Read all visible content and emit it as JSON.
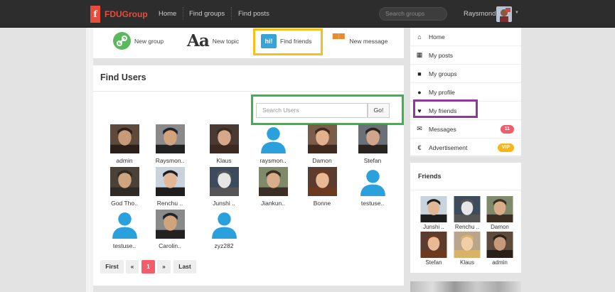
{
  "brand": {
    "logo_glyph": "f",
    "name": "FDUGroup",
    "color": "#e74c3c"
  },
  "nav": {
    "home": "Home",
    "find_groups": "Find groups",
    "find_posts": "Find posts"
  },
  "top_search": {
    "placeholder": "Search groups"
  },
  "user": {
    "name": "Raysmond"
  },
  "actions": {
    "new_group": "New group",
    "new_topic": "New topic",
    "topic_icon_text": "Aa",
    "find_friends": "Find friends",
    "find_friends_icon_text": "hi!",
    "new_message": "New message"
  },
  "main": {
    "title": "Find Users",
    "search_placeholder": "Search Users",
    "go_label": "Go!"
  },
  "users": [
    {
      "name": "admin",
      "pic": "photo"
    },
    {
      "name": "Raysmon..",
      "pic": "photo"
    },
    {
      "name": "Klaus",
      "pic": "photo"
    },
    {
      "name": "raysmon..",
      "pic": "default"
    },
    {
      "name": "Damon",
      "pic": "photo"
    },
    {
      "name": "Stefan",
      "pic": "photo"
    },
    {
      "name": "God Tho..",
      "pic": "photo"
    },
    {
      "name": "Renchu ..",
      "pic": "photo"
    },
    {
      "name": "Junshi ..",
      "pic": "photo"
    },
    {
      "name": "Jiankun..",
      "pic": "photo"
    },
    {
      "name": "Bonne",
      "pic": "photo"
    },
    {
      "name": "testuse..",
      "pic": "default"
    },
    {
      "name": "testuse..",
      "pic": "default"
    },
    {
      "name": "Carolin..",
      "pic": "photo"
    },
    {
      "name": "zyz282",
      "pic": "default"
    }
  ],
  "pagination": {
    "first": "First",
    "prev": "«",
    "current": "1",
    "next": "»",
    "last": "Last"
  },
  "sidebar": {
    "items": [
      {
        "label": "Home",
        "icon": "home-icon",
        "glyph": "⌂"
      },
      {
        "label": "My posts",
        "icon": "posts-icon",
        "glyph": "▦"
      },
      {
        "label": "My groups",
        "icon": "groups-icon",
        "glyph": "■"
      },
      {
        "label": "My profile",
        "icon": "profile-icon",
        "glyph": "●"
      },
      {
        "label": "My friends",
        "icon": "heart-icon",
        "glyph": "♥"
      },
      {
        "label": "Messages",
        "icon": "envelope-icon",
        "glyph": "✉",
        "badge": "11",
        "badge_color": "#f35c6a"
      },
      {
        "label": "Advertisement",
        "icon": "euro-icon",
        "glyph": "€",
        "badge": "VIP",
        "badge_color": "#f5b51c"
      }
    ]
  },
  "friends": {
    "title": "Friends",
    "list": [
      {
        "name": "Junshi .."
      },
      {
        "name": "Renchu .."
      },
      {
        "name": "Damon"
      },
      {
        "name": "Stefan"
      },
      {
        "name": "Klaus"
      },
      {
        "name": "admin"
      }
    ]
  },
  "colors": {
    "highlight_yellow": "#f3c01c",
    "highlight_green": "#3bb54a",
    "highlight_purple": "#8f3a9b",
    "default_avatar": "#2aa0dc"
  }
}
